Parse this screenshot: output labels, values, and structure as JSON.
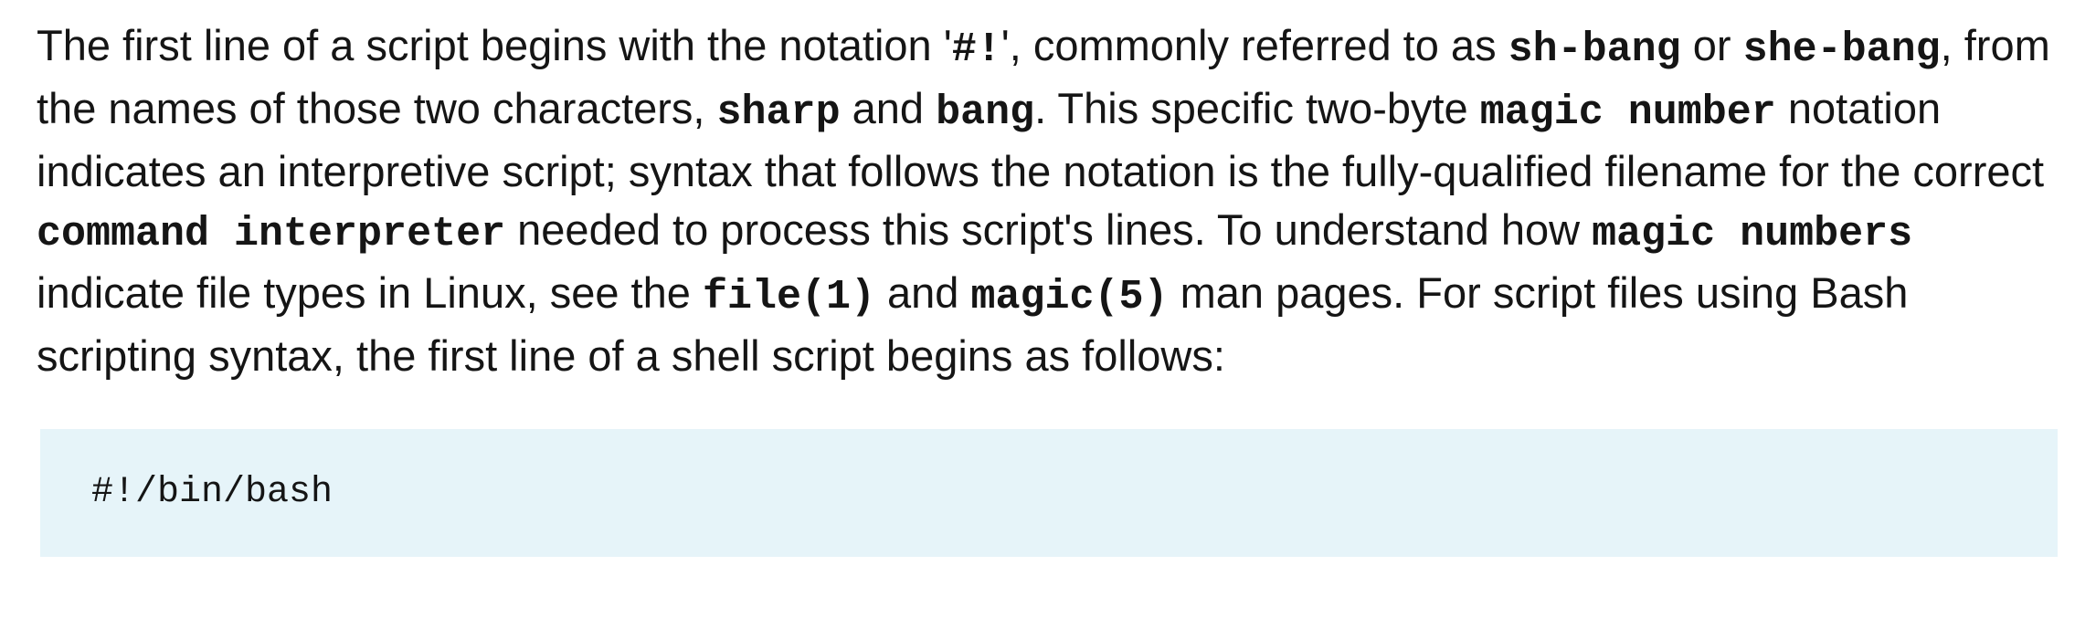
{
  "paragraph": {
    "t1": "The first line of a script begins with the notation '",
    "c_shebang_chars": "#!",
    "t2": "', commonly referred to as ",
    "c_sh_bang": "sh-bang",
    "t3": " or ",
    "c_she_bang": "she-bang",
    "t4": ", from the names of those two characters, ",
    "c_sharp": "sharp",
    "t5": " and ",
    "c_bang": "bang",
    "t6": ". This specific two-byte ",
    "c_magic_number": "magic number",
    "t7": " notation indicates an interpretive script; syntax that follows the notation is the fully-qualified filename for the correct ",
    "c_command_interpreter": "command interpreter",
    "t8": " needed to process this script's lines. To understand how ",
    "c_magic_numbers": "magic numbers",
    "t9": " indicate file types in Linux, see the ",
    "c_file1": "file(1)",
    "t10": " and ",
    "c_magic5": "magic(5)",
    "t11": " man pages. For script files using Bash scripting syntax, the first line of a shell script begins as follows:"
  },
  "code_block": {
    "line": "#!/bin/bash"
  }
}
